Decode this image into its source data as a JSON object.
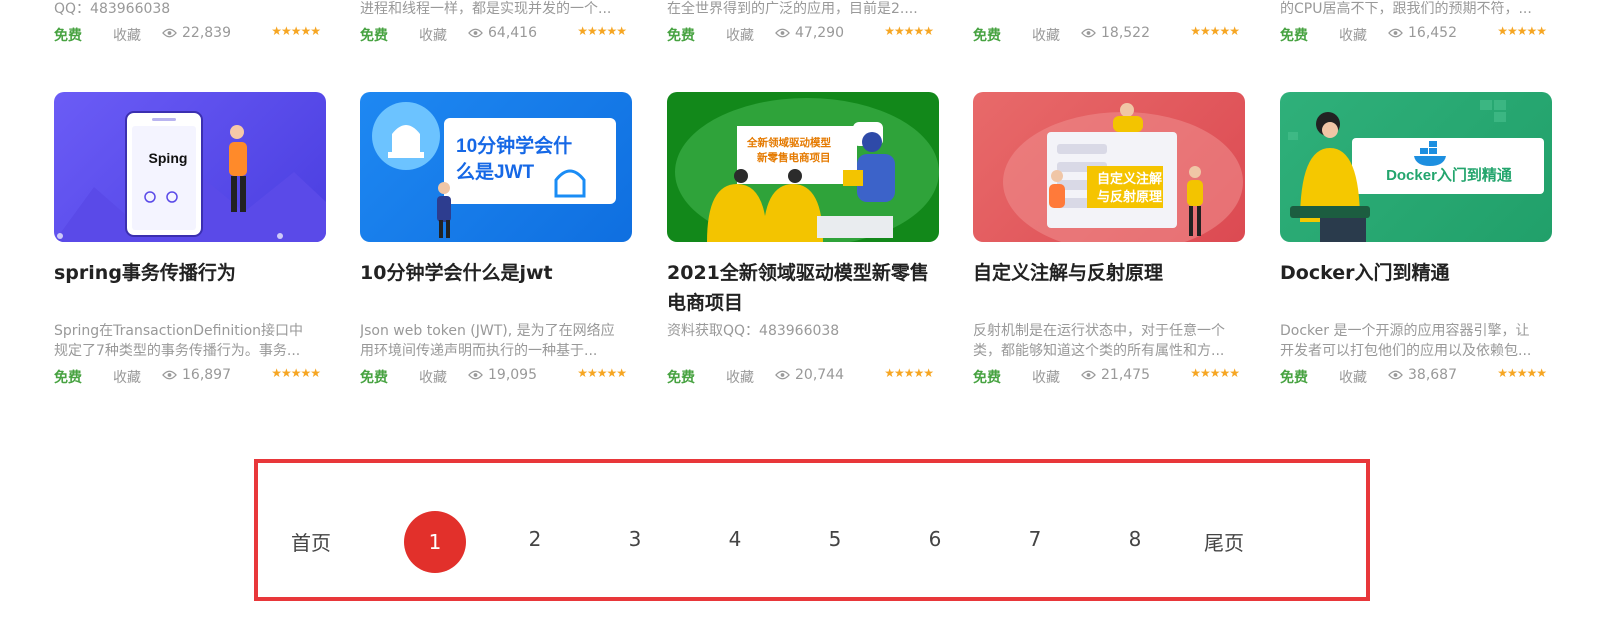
{
  "top_row": [
    {
      "desc": "QQ：483966038",
      "free": "免费",
      "fav": "收藏",
      "views": "22,839",
      "stars": "★★★★★"
    },
    {
      "desc": "进程和线程一样，都是实现并发的一个...",
      "free": "免费",
      "fav": "收藏",
      "views": "64,416",
      "stars": "★★★★★"
    },
    {
      "desc": "在全世界得到的广泛的应用，目前是2....",
      "free": "免费",
      "fav": "收藏",
      "views": "47,290",
      "stars": "★★★★★"
    },
    {
      "desc": "",
      "free": "免费",
      "fav": "收藏",
      "views": "18,522",
      "stars": "★★★★★"
    },
    {
      "desc": "的CPU居高不下，跟我们的预期不符，...",
      "free": "免费",
      "fav": "收藏",
      "views": "16,452",
      "stars": "★★★★★"
    }
  ],
  "cards": [
    {
      "image_text": [
        "Sping"
      ],
      "title": "spring事务传播行为",
      "desc": [
        "Spring在TransactionDefinition接口中",
        "规定了7种类型的事务传播行为。事务..."
      ],
      "free": "免费",
      "fav": "收藏",
      "views": "16,897",
      "stars": "★★★★★"
    },
    {
      "image_text": [
        "10分钟学会什",
        "么是JWT"
      ],
      "title": "10分钟学会什么是jwt",
      "desc": [
        "Json web token (JWT), 是为了在网络应",
        "用环境间传递声明而执行的一种基于..."
      ],
      "free": "免费",
      "fav": "收藏",
      "views": "19,095",
      "stars": "★★★★★"
    },
    {
      "image_text": [
        "全新领域驱动模型",
        "新零售电商项目"
      ],
      "title": "2021全新领域驱动模型新零售电商项目",
      "desc": [
        "资料获取QQ：483966038"
      ],
      "free": "免费",
      "fav": "收藏",
      "views": "20,744",
      "stars": "★★★★★"
    },
    {
      "image_text": [
        "自定义注解",
        "与反射原理"
      ],
      "title": "自定义注解与反射原理",
      "desc": [
        "反射机制是在运行状态中，对于任意一个",
        "类，都能够知道这个类的所有属性和方..."
      ],
      "free": "免费",
      "fav": "收藏",
      "views": "21,475",
      "stars": "★★★★★"
    },
    {
      "image_text": [
        "Docker入门到精通"
      ],
      "title": "Docker入门到精通",
      "desc": [
        "Docker 是一个开源的应用容器引擎，让",
        "开发者可以打包他们的应用以及依赖包..."
      ],
      "free": "免费",
      "fav": "收藏",
      "views": "38,687",
      "stars": "★★★★★"
    }
  ],
  "pagination": {
    "first": "首页",
    "current": "1",
    "pages": [
      "2",
      "3",
      "4",
      "5",
      "6",
      "7",
      "8"
    ],
    "last": "尾页"
  },
  "colors": {
    "free_green": "#48a342",
    "star_orange": "#f6a623",
    "active_page_red": "#e2302b",
    "highlight_border": "#e8373a"
  }
}
